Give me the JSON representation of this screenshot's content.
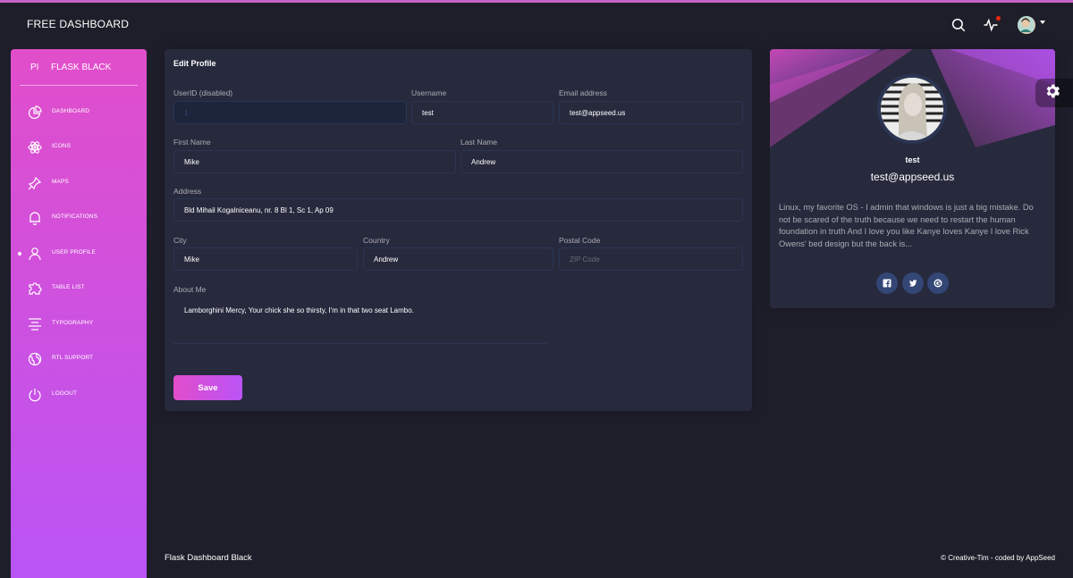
{
  "navbar": {
    "brand": "FREE DASHBOARD",
    "icons": [
      "search-icon",
      "activity-icon",
      "avatar",
      "caret-down-icon"
    ]
  },
  "sidebar": {
    "logo_mini": "PI",
    "logo_text": "FLASK BLACK",
    "items": [
      {
        "label": "DASHBOARD",
        "icon": "chart-pie-icon"
      },
      {
        "label": "ICONS",
        "icon": "atom-icon"
      },
      {
        "label": "MAPS",
        "icon": "pin-icon"
      },
      {
        "label": "NOTIFICATIONS",
        "icon": "bell-icon"
      },
      {
        "label": "USER PROFILE",
        "icon": "user-icon",
        "active": true
      },
      {
        "label": "TABLE LIST",
        "icon": "puzzle-icon"
      },
      {
        "label": "TYPOGRAPHY",
        "icon": "align-center-icon"
      },
      {
        "label": "RTL SUPPORT",
        "icon": "world-icon"
      },
      {
        "label": "LOGOUT",
        "icon": "power-icon"
      }
    ]
  },
  "edit_profile": {
    "title": "Edit Profile",
    "userid": {
      "label": "UserID (disabled)",
      "value": "1"
    },
    "username": {
      "label": "Username",
      "value": "test"
    },
    "email": {
      "label": "Email address",
      "value": "test@appseed.us"
    },
    "first_name": {
      "label": "First Name",
      "value": "Mike"
    },
    "last_name": {
      "label": "Last Name",
      "value": "Andrew"
    },
    "address": {
      "label": "Address",
      "value": "Bld Mihail Kogalniceanu, nr. 8 Bl 1, Sc 1, Ap 09"
    },
    "city": {
      "label": "City",
      "value": "Mike"
    },
    "country": {
      "label": "Country",
      "value": "Andrew"
    },
    "postal_code": {
      "label": "Postal Code",
      "value": "",
      "placeholder": "ZIP Code"
    },
    "about": {
      "label": "About Me",
      "value": "Lamborghini Mercy, Your chick she so thirsty, I'm in that two seat Lambo."
    },
    "save_label": "Save"
  },
  "user_card": {
    "name": "test",
    "email": "test@appseed.us",
    "description": "Linux, my favorite OS - I admin that windows is just a big mistake. Do not be scared of the truth because we need to restart the human foundation in truth And I love you like Kanye loves Kanye I love Rick Owens' bed design but the back is...",
    "social": [
      "facebook-icon",
      "twitter-icon",
      "google-icon"
    ]
  },
  "footer": {
    "left": "Flask Dashboard Black",
    "right": "© Creative-Tim - coded by AppSeed"
  },
  "colors": {
    "accent_start": "#e14eca",
    "accent_end": "#ba54f5",
    "background": "#1e1e2b",
    "card": "#27293d"
  }
}
